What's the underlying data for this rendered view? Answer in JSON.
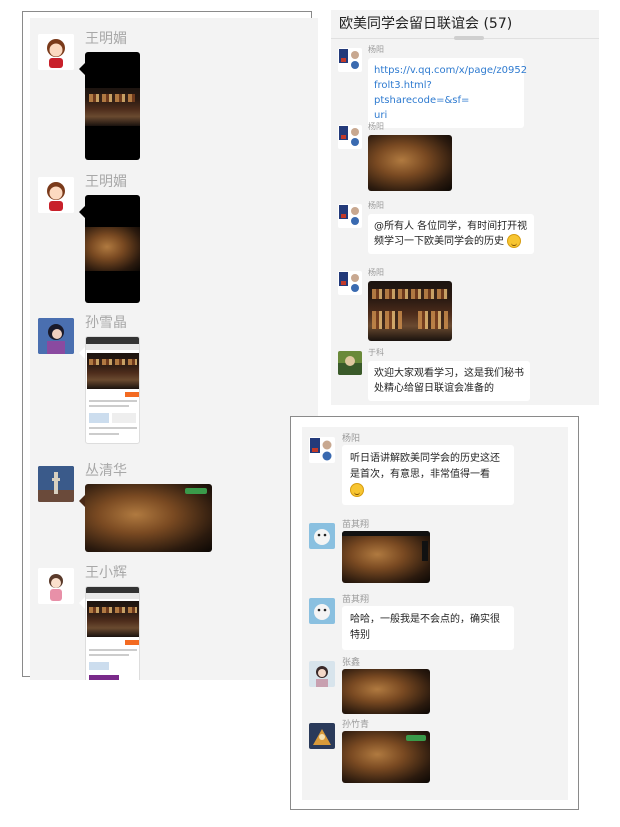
{
  "left": {
    "messages": [
      {
        "name": "王明媚",
        "type": "video"
      },
      {
        "name": "王明媚",
        "type": "video"
      },
      {
        "name": "孙雪晶",
        "type": "screenshot"
      },
      {
        "name": "丛清华",
        "type": "image"
      },
      {
        "name": "王小辉",
        "type": "screenshot"
      }
    ]
  },
  "top_right": {
    "title": "欧美同学会留日联谊会 (57)",
    "messages": [
      {
        "name": "杨阳",
        "text": "https://v.qq.com/x/page/z0952frolt3.html?ptsharecode=&sf=uri",
        "line1": "https://v.qq.com/x/page/z0952",
        "line2": "frolt3.html?ptsharecode=&sf=",
        "line3": "uri"
      },
      {
        "name": "杨阳",
        "type": "image"
      },
      {
        "name": "杨阳",
        "line1": "@所有人 各位同学，有时间打开视",
        "line2": "频学习一下欧美同学会的历史"
      },
      {
        "name": "杨阳",
        "type": "image"
      },
      {
        "name": "于科",
        "line1": "欢迎大家观看学习，这是我们秘书",
        "line2": "处精心给留日联谊会准备的"
      }
    ]
  },
  "bottom_right": {
    "messages": [
      {
        "name": "杨阳",
        "line1": "听日语讲解欧美同学会的历史这还",
        "line2": "是首次，有意思，非常值得一看"
      },
      {
        "name": "苗其翔",
        "type": "image"
      },
      {
        "name": "苗其翔",
        "line1": "哈哈，一般我是不会点的，确实很",
        "line2": "特别"
      },
      {
        "name": "张鑫",
        "type": "image"
      },
      {
        "name": "孙竹青",
        "type": "image"
      }
    ]
  }
}
